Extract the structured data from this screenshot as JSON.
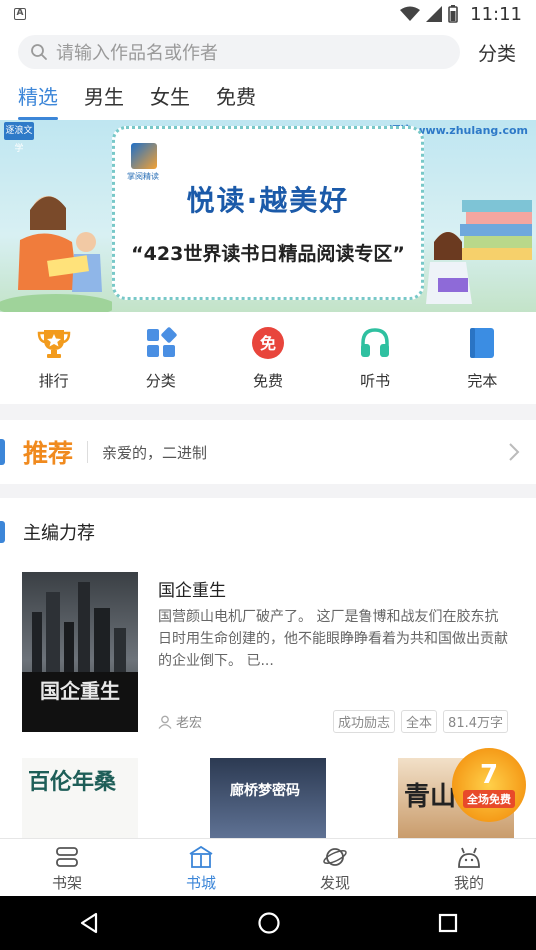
{
  "status_bar": {
    "time": "11:11"
  },
  "search": {
    "placeholder": "请输入作品名或作者",
    "category_label": "分类"
  },
  "tabs": [
    {
      "label": "精选",
      "active": true
    },
    {
      "label": "男生",
      "active": false
    },
    {
      "label": "女生",
      "active": false
    },
    {
      "label": "免费",
      "active": false
    }
  ],
  "banner": {
    "corner_left": "逐浪文学",
    "corner_right": "逐浪 www.zhulang.com",
    "logo_text": "掌阅精读",
    "slogan": "悦读·越美好",
    "subtitle": "“423世界读书日精品阅读专区”"
  },
  "quick_nav": [
    {
      "label": "排行",
      "icon": "trophy-icon",
      "color": "#f29b1d"
    },
    {
      "label": "分类",
      "icon": "grid-icon",
      "color": "#4a8fe3"
    },
    {
      "label": "免费",
      "icon": "free-icon",
      "color": "#e8453c"
    },
    {
      "label": "听书",
      "icon": "headphones-icon",
      "color": "#2fc0a0"
    },
    {
      "label": "完本",
      "icon": "book-icon",
      "color": "#3b8de3"
    }
  ],
  "recommend": {
    "title": "推荐",
    "subtitle": "亲爱的，二进制"
  },
  "section": {
    "title": "主编力荐"
  },
  "featured_book": {
    "title": "国企重生",
    "description": "国营颜山电机厂破产了。 这厂是鲁博和战友们在胶东抗日时用生命创建的，他不能眼睁睁看着为共和国做出贡献的企业倒下。 已...",
    "author": "老宏",
    "tags": [
      "成功励志",
      "全本",
      "81.4万字"
    ],
    "cover_text": "国企重生"
  },
  "more_books": [
    {
      "cover_text": "百伦年桑"
    },
    {
      "cover_text": "廊桥梦密码"
    },
    {
      "cover_text": "青山"
    }
  ],
  "promo": {
    "number": "7",
    "label": "全场免费"
  },
  "bottom_nav": [
    {
      "label": "书架",
      "icon": "bookshelf-icon",
      "active": false
    },
    {
      "label": "书城",
      "icon": "bookstore-icon",
      "active": true
    },
    {
      "label": "发现",
      "icon": "planet-icon",
      "active": false
    },
    {
      "label": "我的",
      "icon": "profile-icon",
      "active": false
    }
  ],
  "colors": {
    "accent": "#3c86d8",
    "recommend_orange": "#f08a1e"
  }
}
